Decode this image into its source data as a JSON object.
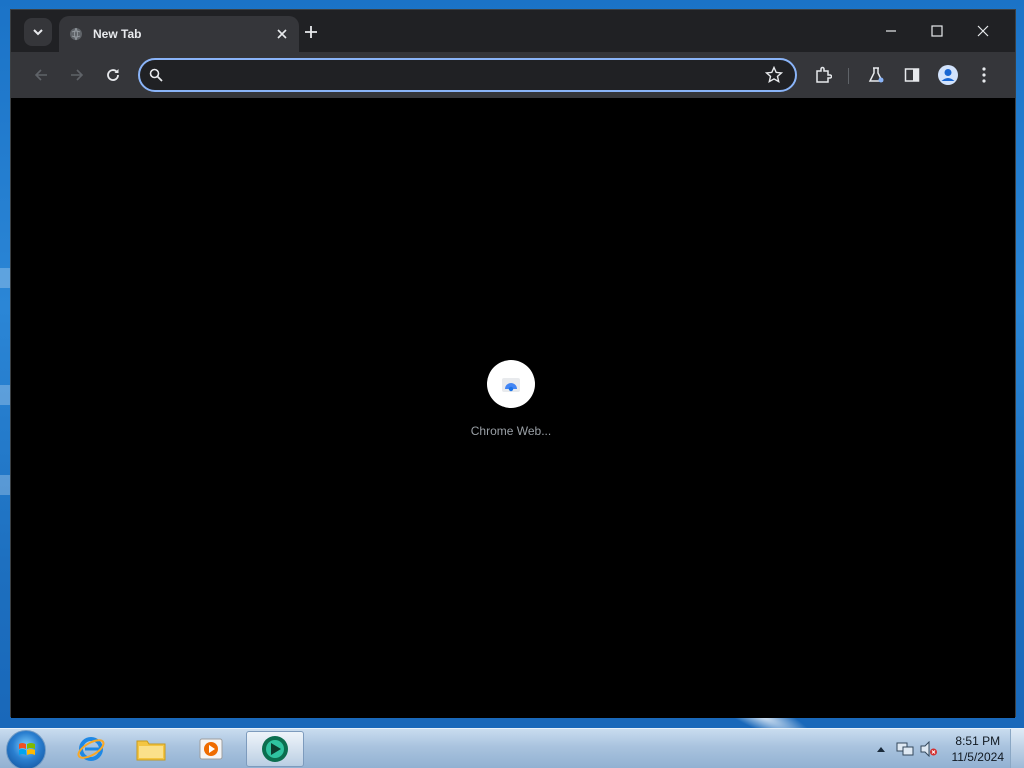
{
  "browser": {
    "tab": {
      "title": "New Tab",
      "favicon": "globe-icon",
      "close_icon": "close-icon"
    },
    "tab_search_icon": "chevron-down-icon",
    "new_tab_icon": "plus-icon",
    "window_controls": [
      "minimize-icon",
      "maximize-icon",
      "close-icon"
    ],
    "toolbar": {
      "back_icon": "arrow-left-icon",
      "forward_icon": "arrow-right-icon",
      "reload_icon": "reload-icon",
      "omnibox": {
        "value": "",
        "placeholder": "",
        "search_icon": "search-icon",
        "bookmark_icon": "star-icon"
      },
      "right_icons": [
        "extensions-icon",
        "labs-icon",
        "side-panel-icon",
        "profile-icon",
        "menu-icon"
      ]
    },
    "new_tab_page": {
      "shortcuts": [
        {
          "label": "Chrome Web...",
          "icon": "chrome-web-store-icon"
        }
      ]
    }
  },
  "taskbar": {
    "pinned_apps": [
      "internet-explorer-icon",
      "file-explorer-icon",
      "media-player-icon",
      "chrome-app-icon"
    ],
    "tray_icons": [
      "show-hidden-icons-chevron",
      "network-icon",
      "volume-muted-icon"
    ],
    "clock": {
      "time": "8:51 PM",
      "date": "11/5/2024"
    }
  },
  "colors": {
    "accent": "#8ab4f8",
    "browser_frame": "#202124",
    "toolbar": "#35363a",
    "page_bg": "#000000"
  }
}
